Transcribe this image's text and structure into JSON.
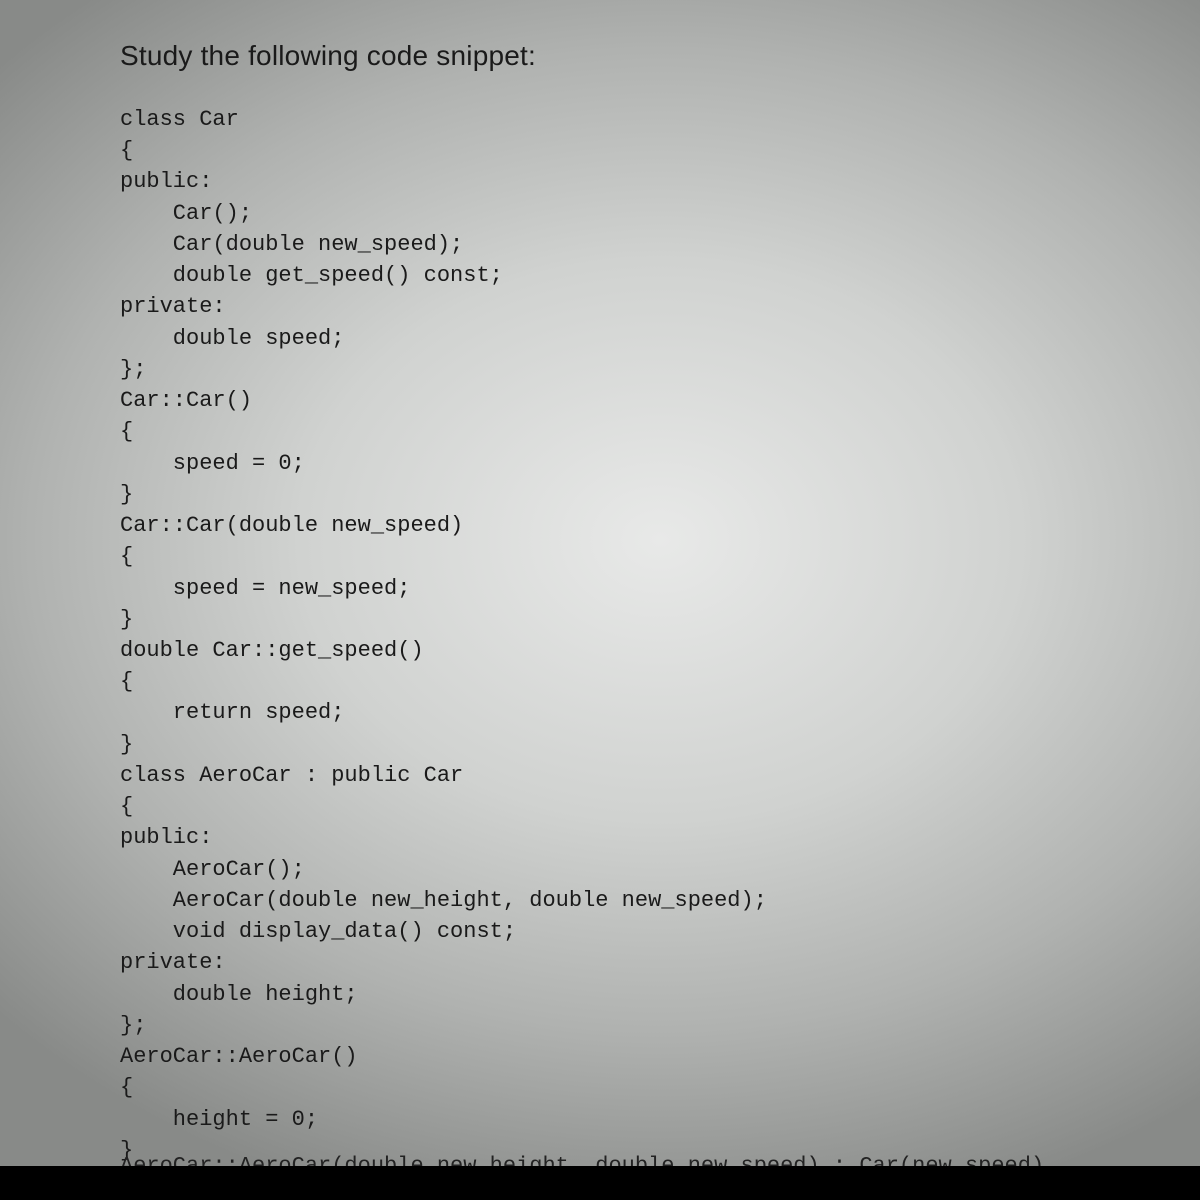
{
  "heading": "Study the following code snippet:",
  "code_lines": [
    "class Car",
    "{",
    "public:",
    "    Car();",
    "    Car(double new_speed);",
    "    double get_speed() const;",
    "private:",
    "    double speed;",
    "};",
    "Car::Car()",
    "{",
    "    speed = 0;",
    "}",
    "Car::Car(double new_speed)",
    "{",
    "    speed = new_speed;",
    "}",
    "double Car::get_speed()",
    "{",
    "    return speed;",
    "}",
    "class AeroCar : public Car",
    "{",
    "public:",
    "    AeroCar();",
    "    AeroCar(double new_height, double new_speed);",
    "    void display_data() const;",
    "private:",
    "    double height;",
    "};",
    "AeroCar::AeroCar()",
    "{",
    "    height = 0;",
    "}"
  ],
  "cutoff_line": "AeroCar::AeroCar(double new_height, double new_speed) : Car(new_speed)"
}
